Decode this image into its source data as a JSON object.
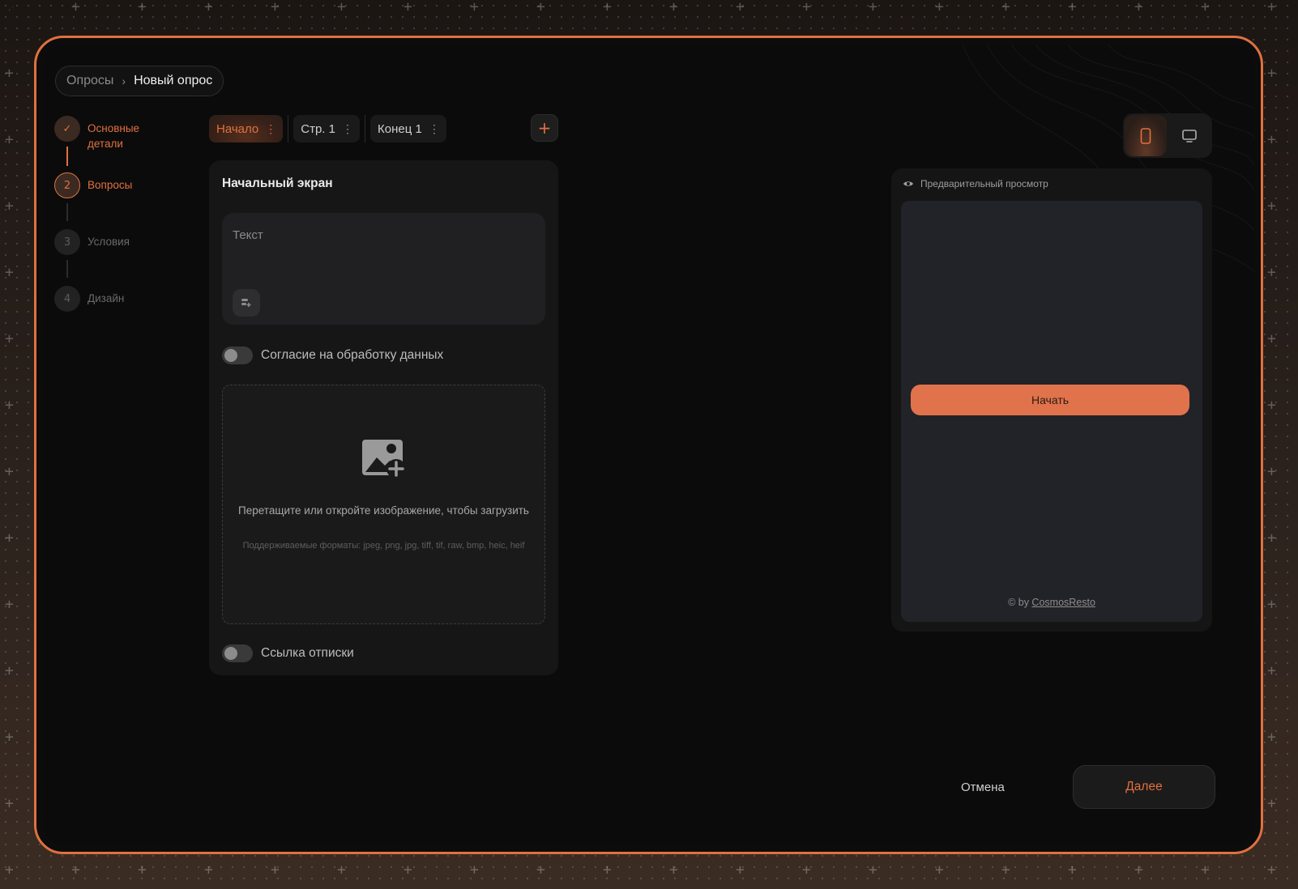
{
  "breadcrumb": {
    "parent": "Опросы",
    "separator": "›",
    "current": "Новый опрос"
  },
  "steps": [
    {
      "number": "✓",
      "label": "Основные детали",
      "state": "done"
    },
    {
      "number": "2",
      "label": "Вопросы",
      "state": "active"
    },
    {
      "number": "3",
      "label": "Условия",
      "state": "pending"
    },
    {
      "number": "4",
      "label": "Дизайн",
      "state": "pending"
    }
  ],
  "page_tabs": [
    {
      "label": "Начало",
      "active": true
    },
    {
      "label": "Стр. 1",
      "active": false
    },
    {
      "label": "Конец 1",
      "active": false
    }
  ],
  "tab_menu_glyph": "⋮",
  "add_page_label": "+",
  "editor": {
    "title": "Начальный экран",
    "text_placeholder": "Текст",
    "consent_toggle": {
      "label": "Согласие на обработку данных",
      "on": false
    },
    "dropzone": {
      "text": "Перетащите или откройте изображение, чтобы загрузить",
      "hint": "Поддерживаемые форматы: jpeg, png, jpg, tiff, tif, raw, bmp, heic, heif"
    },
    "unsubscribe_toggle": {
      "label": "Ссылка отписки",
      "on": false
    }
  },
  "preview": {
    "header": "Предварительный просмотр",
    "start_button": "Начать",
    "footer_prefix": "© by ",
    "footer_brand": "CosmosResto"
  },
  "actions": {
    "cancel": "Отмена",
    "next": "Далее"
  },
  "colors": {
    "accent": "#e0713f",
    "frame_bg": "#0b0b0b",
    "card_bg": "#161616"
  },
  "icons": {
    "check": "check-icon",
    "text_tool": "text-style-icon",
    "image_add": "image-add-icon",
    "mobile": "mobile-icon",
    "desktop": "desktop-icon",
    "eye": "eye-icon"
  }
}
